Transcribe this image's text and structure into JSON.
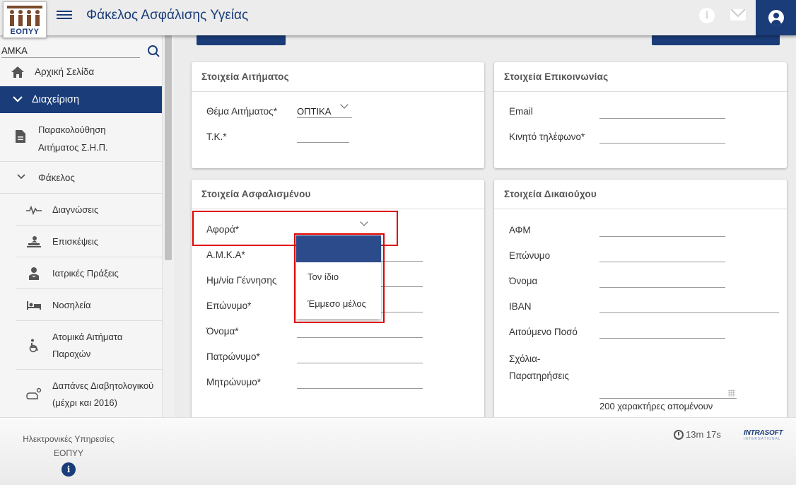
{
  "header": {
    "logo_text": "ΕΟΠΥΥ",
    "title": "Φάκελος Ασφάλισης Υγείας",
    "icons": [
      "menu-icon",
      "info-icon",
      "mail-icon",
      "user-icon"
    ]
  },
  "sidebar": {
    "search_value": "ΑΜΚΑ",
    "home": "Αρχική Σελίδα",
    "manage": "Διαχείριση",
    "track_line1": "Παρακολούθηση",
    "track_line2": "Αιτήματος Σ.Η.Π.",
    "folder": "Φάκελος",
    "sub": [
      {
        "label": "Διαγνώσεις",
        "icon": "pulse-icon"
      },
      {
        "label": "Επισκέψεις",
        "icon": "patient-icon"
      },
      {
        "label": "Ιατρικές Πράξεις",
        "icon": "doctor-icon"
      },
      {
        "label": "Νοσηλεία",
        "icon": "bed-icon"
      },
      {
        "label_line1": "Ατομικά Αιτήματα",
        "label_line2": "Παροχών",
        "icon": "wheelchair-icon"
      },
      {
        "label_line1": "Δαπάνες Διαβητολογικού",
        "label_line2": "(μέχρι και 2016)",
        "icon": "diabetes-icon"
      }
    ]
  },
  "cards": {
    "request": {
      "title": "Στοιχεία Αιτήματος",
      "subject_label": "Θέμα Αιτήματος*",
      "subject_value": "ΟΠΤΙΚΑ",
      "zip_label": "Τ.Κ.*"
    },
    "contact": {
      "title": "Στοιχεία Επικοινωνίας",
      "email_label": "Email",
      "mobile_label": "Κινητό τηλέφωνο*"
    },
    "insured": {
      "title": "Στοιχεία Ασφαλισμένου",
      "concerns_label": "Αφορά*",
      "amka_label": "Α.Μ.Κ.Α*",
      "dob_label": "Ημ/νία Γέννησης",
      "surname_label": "Επώνυμο*",
      "name_label": "Όνομα*",
      "father_label": "Πατρώνυμο*",
      "mother_label": "Μητρώνυμο*",
      "dropdown_options": [
        "",
        "Τον ίδιο",
        "Έμμεσο μέλος"
      ]
    },
    "beneficiary": {
      "title": "Στοιχεία Δικαιούχου",
      "afm_label": "ΑΦΜ",
      "surname_label": "Επώνυμο",
      "name_label": "Όνομα",
      "iban_label": "IBAN",
      "amount_label": "Αιτούμενο Ποσό",
      "comments_line1": "Σχόλια-",
      "comments_line2": "Παρατηρήσεις",
      "chars_left": "200 χαρακτήρες απομένουν"
    }
  },
  "footer": {
    "org_line1": "Ηλεκτρονικές Υπηρεσίες",
    "org_line2": "ΕΟΠΥΥ",
    "timer": "13m 17s",
    "brand": "INTRASOFT",
    "brand_sub": "INTERNATIONAL"
  },
  "colors": {
    "primary": "#1a3c78",
    "highlight": "#e00000"
  }
}
